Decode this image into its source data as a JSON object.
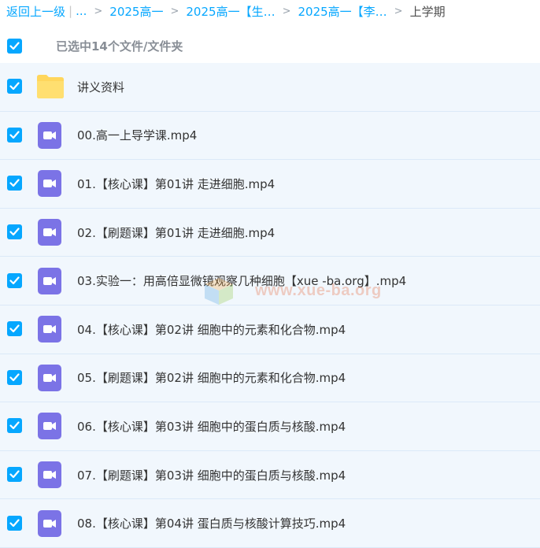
{
  "breadcrumb": {
    "back": "返回上一级",
    "ellipsis": "...",
    "items": [
      "2025高一",
      "2025高一【生…",
      "2025高一【李…"
    ],
    "current": "上学期"
  },
  "selection": {
    "text": "已选中14个文件/文件夹",
    "checked": true
  },
  "files": [
    {
      "name": "讲义资料",
      "type": "folder",
      "icon": "folder-icon"
    },
    {
      "name": "00.高一上导学课.mp4",
      "type": "video",
      "icon": "video-file-icon"
    },
    {
      "name": "01.【核心课】第01讲 走进细胞.mp4",
      "type": "video",
      "icon": "video-file-icon"
    },
    {
      "name": "02.【刷题课】第01讲 走进细胞.mp4",
      "type": "video",
      "icon": "video-file-icon"
    },
    {
      "name": "03.实验一：用高倍显微镜观察几种细胞【xue -ba.org】.mp4",
      "type": "video",
      "icon": "video-file-icon"
    },
    {
      "name": "04.【核心课】第02讲 细胞中的元素和化合物.mp4",
      "type": "video",
      "icon": "video-file-icon"
    },
    {
      "name": "05.【刷题课】第02讲 细胞中的元素和化合物.mp4",
      "type": "video",
      "icon": "video-file-icon"
    },
    {
      "name": "06.【核心课】第03讲 细胞中的蛋白质与核酸.mp4",
      "type": "video",
      "icon": "video-file-icon"
    },
    {
      "name": "07.【刷题课】第03讲 细胞中的蛋白质与核酸.mp4",
      "type": "video",
      "icon": "video-file-icon"
    },
    {
      "name": "08.【核心课】第04讲 蛋白质与核酸计算技巧.mp4",
      "type": "video",
      "icon": "video-file-icon"
    }
  ],
  "watermark": {
    "text": "www.xue-ba.org"
  },
  "colors": {
    "accent": "#06a7ff",
    "row_bg": "#f1f7fd",
    "folder": "#ffd65c",
    "video": "#7b73e6"
  }
}
